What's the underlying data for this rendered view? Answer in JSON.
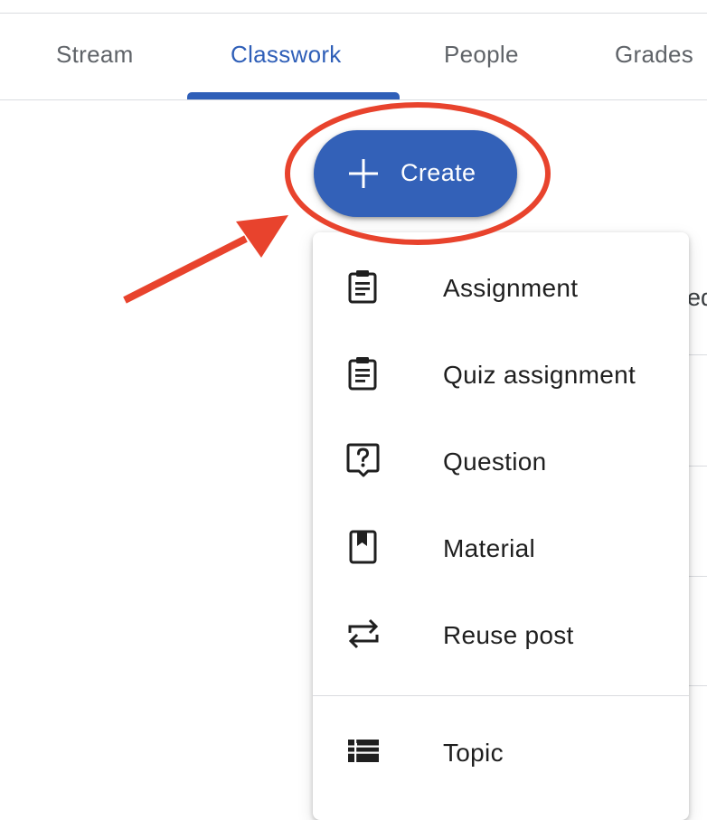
{
  "tabs": {
    "stream": "Stream",
    "classwork": "Classwork",
    "people": "People",
    "grades": "Grades"
  },
  "create_button": {
    "label": "Create",
    "icon": "plus-icon"
  },
  "background_text": "ed",
  "menu": {
    "items": [
      {
        "label": "Assignment",
        "icon": "assignment-icon"
      },
      {
        "label": "Quiz assignment",
        "icon": "quiz-assignment-icon"
      },
      {
        "label": "Question",
        "icon": "question-icon"
      },
      {
        "label": "Material",
        "icon": "material-icon"
      },
      {
        "label": "Reuse post",
        "icon": "reuse-post-icon"
      },
      {
        "label": "Topic",
        "icon": "topic-icon"
      }
    ]
  },
  "colors": {
    "accent": "#2f5fb8",
    "button": "#3361b8",
    "annotation": "#e8432d"
  }
}
